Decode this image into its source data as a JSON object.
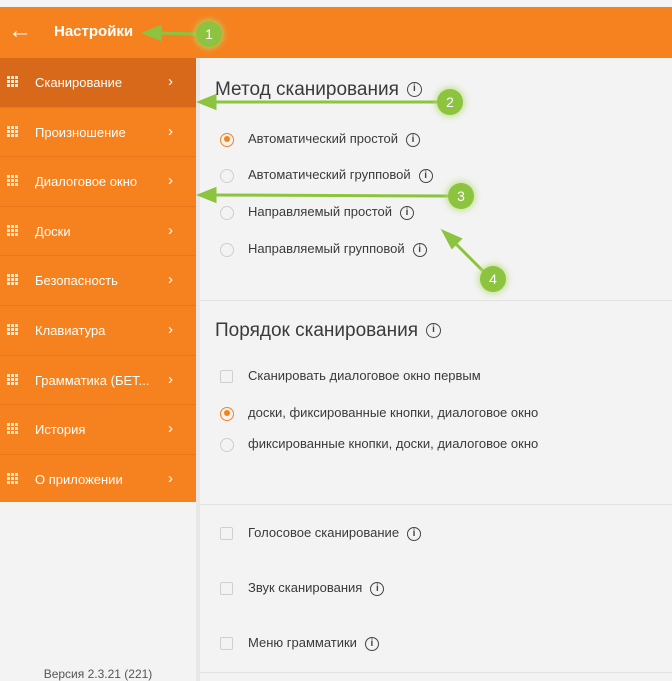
{
  "header": {
    "back_icon": "arrow-left-icon",
    "title": "Настройки"
  },
  "sidebar": {
    "items": [
      {
        "label": "Сканирование",
        "active": true
      },
      {
        "label": "Произношение"
      },
      {
        "label": "Диалоговое окно"
      },
      {
        "label": "Доски"
      },
      {
        "label": "Безопасность"
      },
      {
        "label": "Клавиатура"
      },
      {
        "label": "Грамматика (БЕТ..."
      },
      {
        "label": "История"
      },
      {
        "label": "О приложении"
      }
    ],
    "version": "Версия 2.3.21 (221)"
  },
  "scan_method": {
    "title": "Метод сканирования",
    "options": [
      {
        "label": "Автоматический простой",
        "selected": true
      },
      {
        "label": "Автоматический групповой"
      },
      {
        "label": "Направляемый простой"
      },
      {
        "label": "Направляемый групповой"
      }
    ]
  },
  "scan_order": {
    "title": "Порядок сканирования",
    "checkbox": "Сканировать диалоговое окно первым",
    "options": [
      {
        "label": "доски, фиксированные кнопки, диалоговое окно",
        "selected": true
      },
      {
        "label": "фиксированные кнопки, доски, диалоговое окно"
      }
    ]
  },
  "extras": {
    "voice_scan": "Голосовое сканирование",
    "scan_sound": "Звук сканирования",
    "grammar_menu": "Меню грамматики"
  },
  "annotations": [
    "1",
    "2",
    "3",
    "4"
  ],
  "colors": {
    "accent": "#f5821f",
    "active": "#d9691a",
    "badge": "#8cc43f"
  }
}
